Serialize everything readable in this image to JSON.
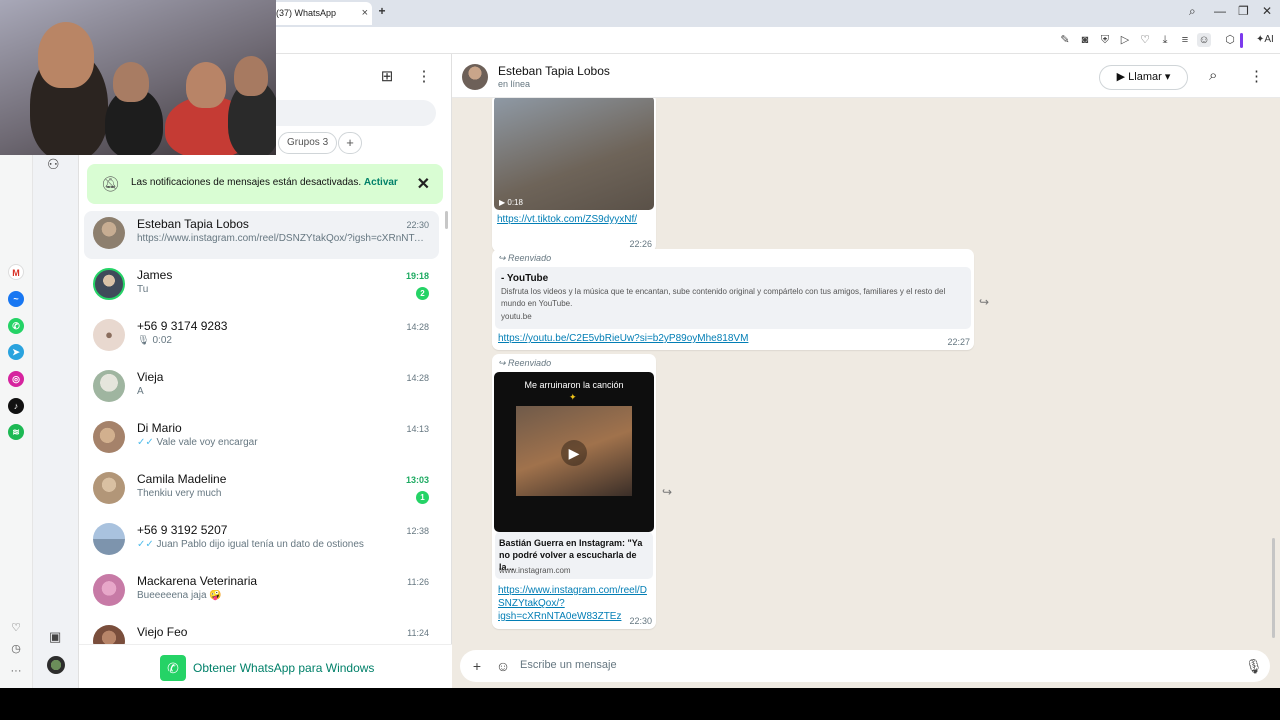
{
  "browser": {
    "tab_title": "(37) WhatsApp",
    "ai_label": "AI"
  },
  "chat_list": {
    "notification": {
      "text": "Las notificaciones de mensajes están desactivadas.",
      "link": "Activar"
    },
    "chips": [
      {
        "label": "Grupos 3"
      }
    ],
    "chats": [
      {
        "name": "Esteban Tapia Lobos",
        "message": "https://www.instagram.com/reel/DSNZYtakQox/?igsh=cXRnNTA0eW83ZTEz",
        "time": "22:30",
        "unread": "",
        "color": "#8d7f6e"
      },
      {
        "name": "James",
        "message": "Tu",
        "time": "19:18",
        "unread": "2",
        "color": "#3f4a5a"
      },
      {
        "name": "+56 9 3174 9283",
        "message": "0:02",
        "time": "14:28",
        "unread": "",
        "color": "#dfe5e7"
      },
      {
        "name": "Vieja",
        "message": "A",
        "time": "14:28",
        "unread": "",
        "color": "#9fb5a0"
      },
      {
        "name": "Di Mario",
        "message": "Vale vale voy encargar",
        "time": "14:13",
        "unread": "",
        "color": "#a5826a"
      },
      {
        "name": "Camila Madeline",
        "message": "Thenkiu very much",
        "time": "13:03",
        "unread": "1",
        "color": "#b29678"
      },
      {
        "name": "+56 9 3192 5207",
        "message": "Juan Pablo dijo igual tenía un dato de ostiones",
        "time": "12:38",
        "unread": "",
        "color": "#7d94ad"
      },
      {
        "name": "Mackarena Veterinaria",
        "message": "Bueeeeena jaja 🤪",
        "time": "11:26",
        "unread": "",
        "color": "#c77aa6"
      },
      {
        "name": "Viejo Feo",
        "message": "",
        "time": "11:24",
        "unread": "",
        "color": "#7a4e3c"
      }
    ],
    "get_app": "Obtener WhatsApp para Windows"
  },
  "chat": {
    "contact_name": "Esteban Tapia Lobos",
    "status": "en línea",
    "call_label": "Llamar",
    "messages": {
      "m1": {
        "link": "https://vt.tiktok.com/ZS9dyyxNf/",
        "time": "22:26",
        "duration": "0:18"
      },
      "m2": {
        "forwarded": "Reenviado",
        "preview_title": "- YouTube",
        "preview_desc": "Disfruta los videos y la música que te encantan, sube contenido original y compártelo con tus amigos, familiares y el resto del mundo en YouTube.",
        "preview_domain": "youtu.be",
        "link": "https://youtu.be/C2E5vbRieUw?si=b2yP89oyMhe818VM",
        "time": "22:27"
      },
      "m3": {
        "forwarded": "Reenviado",
        "video_caption": "Me arruinaron la canción",
        "preview_title": "Bastián Guerra en Instagram: \"Ya no podré volver a escucharla de la...",
        "preview_domain": "www.instagram.com",
        "link_1": "https://www.instagram.com/reel/D",
        "link_2": "SNZYtakQox/?",
        "link_3": "igsh=cXRnNTA0eW83ZTEz",
        "time": "22:30"
      }
    },
    "composer_placeholder": "Escribe un mensaje"
  },
  "colors": {
    "accent": "#25d366",
    "link": "#027eb5",
    "chat_bg": "#efeae2",
    "notif_bg": "#d9fdd3"
  }
}
